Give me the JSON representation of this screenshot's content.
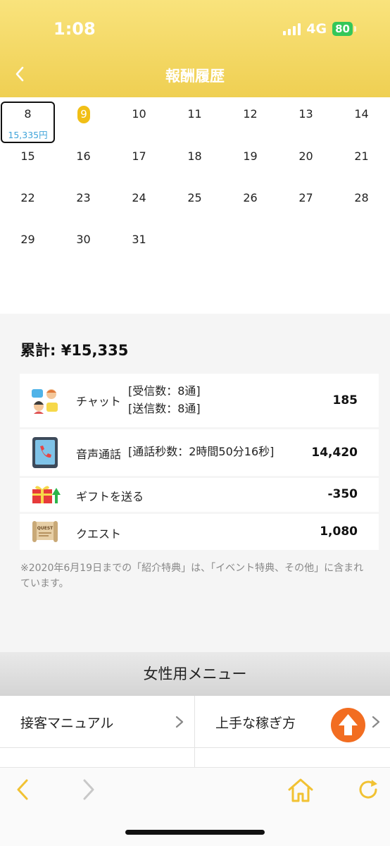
{
  "status_bar": {
    "time": "1:08",
    "network": "4G",
    "battery": "80"
  },
  "header": {
    "title": "報酬履歴"
  },
  "calendar": {
    "days": [
      {
        "day": "8",
        "amount": "15,335円",
        "selected": true
      },
      {
        "day": "9",
        "today": true
      },
      {
        "day": "10"
      },
      {
        "day": "11"
      },
      {
        "day": "12"
      },
      {
        "day": "13"
      },
      {
        "day": "14"
      },
      {
        "day": "15"
      },
      {
        "day": "16"
      },
      {
        "day": "17"
      },
      {
        "day": "18"
      },
      {
        "day": "19"
      },
      {
        "day": "20"
      },
      {
        "day": "21"
      },
      {
        "day": "22"
      },
      {
        "day": "23"
      },
      {
        "day": "24"
      },
      {
        "day": "25"
      },
      {
        "day": "26"
      },
      {
        "day": "27"
      },
      {
        "day": "28"
      },
      {
        "day": "29"
      },
      {
        "day": "30"
      },
      {
        "day": "31"
      }
    ]
  },
  "summary": {
    "total": "累計: ¥15,335",
    "items": [
      {
        "icon": "chat-people-icon",
        "label": "チャット",
        "detail1": "[受信数：8通]",
        "detail2": "[送信数：8通]",
        "value": "185"
      },
      {
        "icon": "phone-tablet-icon",
        "label": "音声通話",
        "detail1": "[通話秒数：2時間50分16秒]",
        "value": "14,420"
      },
      {
        "icon": "gift-up-icon",
        "label": "ギフトを送る",
        "value": "-350"
      },
      {
        "icon": "quest-scroll-icon",
        "label": "クエスト",
        "value": "1,080"
      }
    ],
    "note": "※2020年6月19日までの「紹介特典」は、「イベント特典、その他」に含まれています。"
  },
  "menu": {
    "title": "女性用メニュー",
    "items": [
      {
        "label": "接客マニュアル"
      },
      {
        "label": "上手な稼ぎ方"
      }
    ]
  },
  "colors": {
    "header_gradient_top": "#f9e37c",
    "header_gradient_bottom": "#efcf52",
    "accent_yellow": "#f1bf16",
    "amount_blue": "#3ea3d9",
    "up_button": "#f26d21",
    "browser_icon": "#f1c233"
  }
}
